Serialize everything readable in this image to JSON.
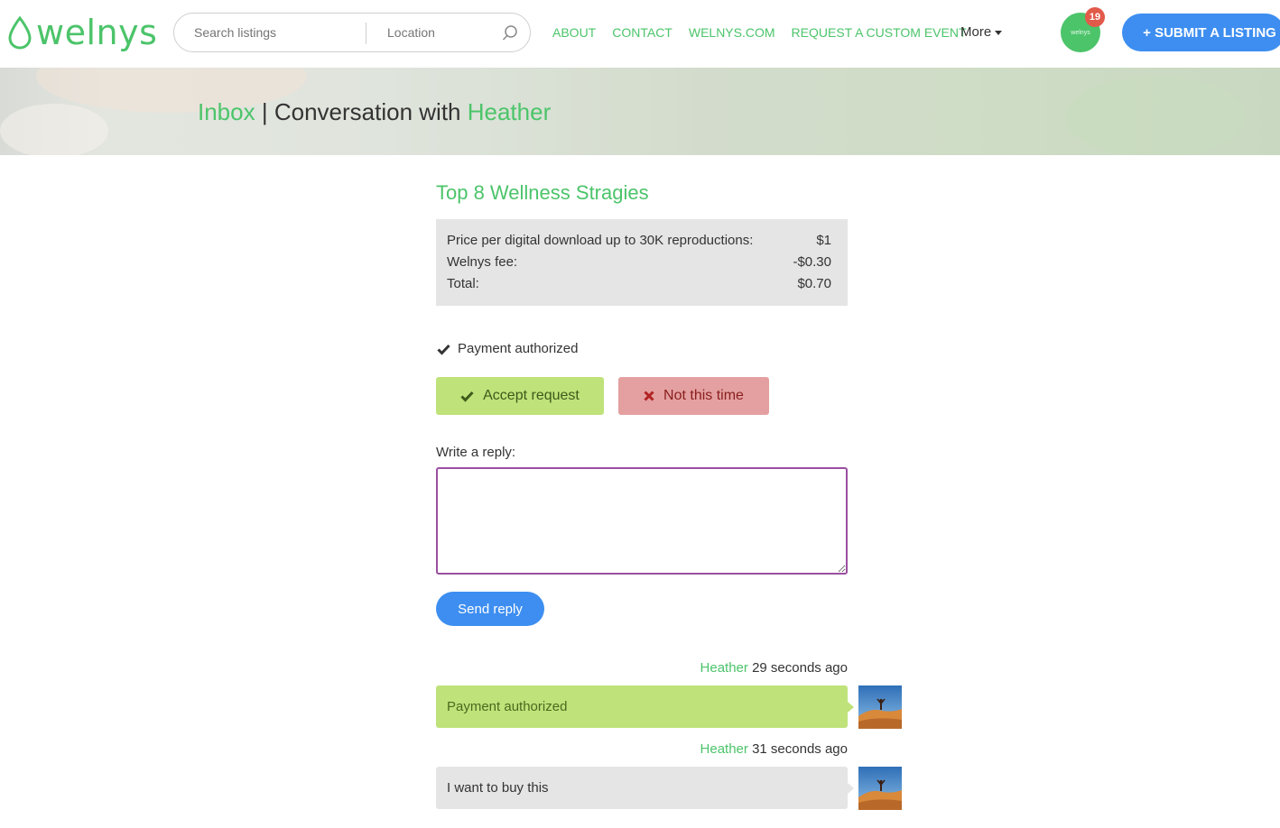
{
  "brand": {
    "name": "welnys",
    "accent": "#4cc46a",
    "blue": "#3d8ef0"
  },
  "search": {
    "keyword_placeholder": "Search listings",
    "location_placeholder": "Location",
    "icon": "search-icon"
  },
  "nav": {
    "items": [
      "ABOUT",
      "CONTACT",
      "WELNYS.COM",
      "REQUEST A CUSTOM EVENT"
    ],
    "more_label": "More"
  },
  "user": {
    "avatar_text": "welnys",
    "notification_count": "19"
  },
  "submit_listing_label": "+ SUBMIT A LISTING",
  "banner": {
    "inbox": "Inbox",
    "separator": "|",
    "conversation_prefix": "Conversation with",
    "contact_name": "Heather"
  },
  "listing": {
    "title": "Top 8 Wellness Stragies",
    "price_rows": [
      {
        "label": "Price per digital download up to 30K reproductions:",
        "value": "$1"
      },
      {
        "label": "Welnys fee:",
        "value": "-$0.30"
      },
      {
        "label": "Total:",
        "value": "$0.70"
      }
    ]
  },
  "status": {
    "text": "Payment authorized",
    "icon": "check-icon"
  },
  "actions": {
    "accept_label": "Accept request",
    "decline_label": "Not this time"
  },
  "reply": {
    "label": "Write a reply:",
    "value": "",
    "send_label": "Send reply"
  },
  "messages": [
    {
      "author": "Heather",
      "time": "29 seconds ago",
      "text": "Payment authorized",
      "style": "green"
    },
    {
      "author": "Heather",
      "time": "31 seconds ago",
      "text": "I want to buy this",
      "style": "grey"
    }
  ]
}
